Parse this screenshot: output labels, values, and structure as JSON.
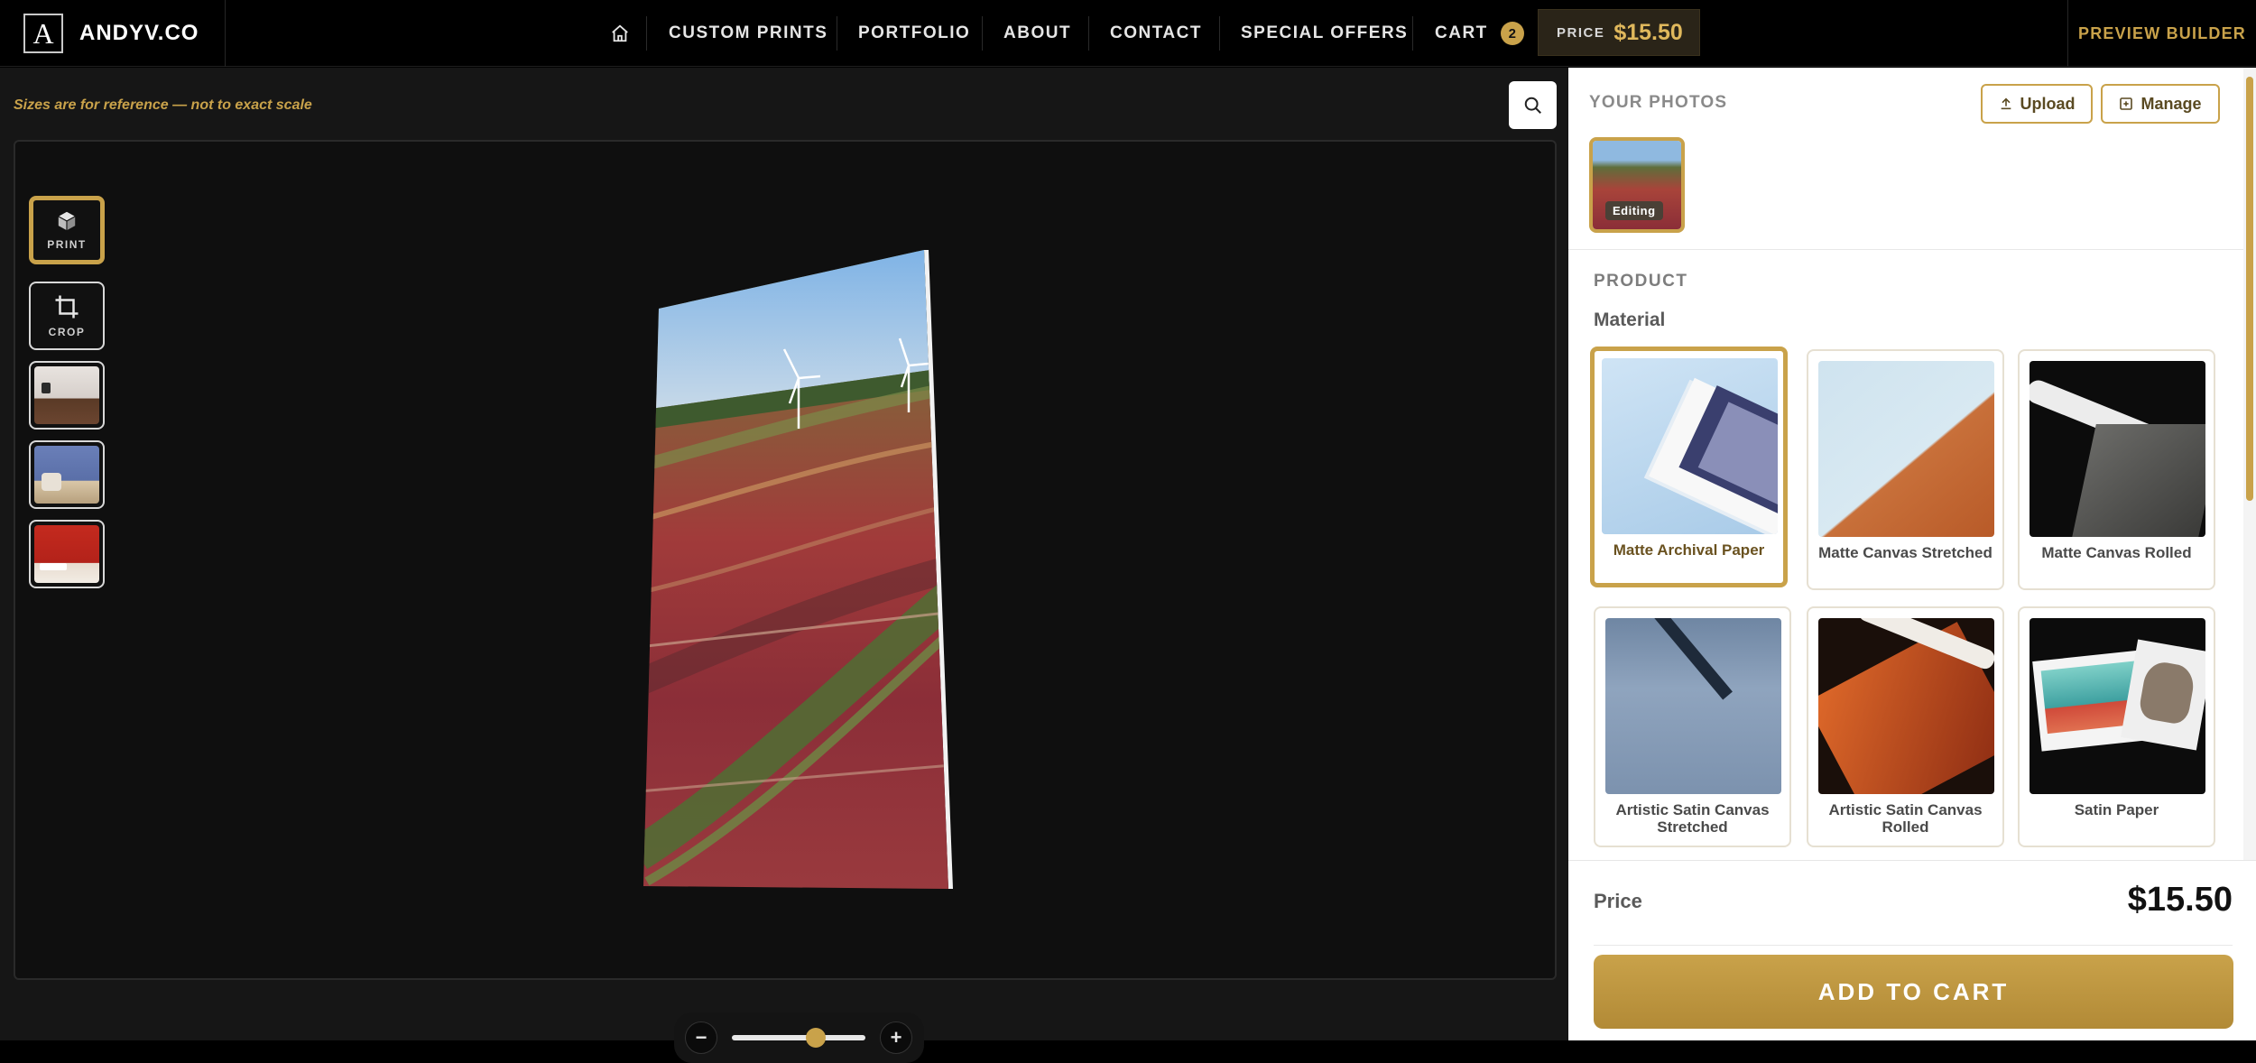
{
  "brand": {
    "logo_letter": "A",
    "name": "ANDYV.CO"
  },
  "nav": {
    "home_icon": "home-icon",
    "links": [
      "CUSTOM PRINTS",
      "PORTFOLIO",
      "ABOUT",
      "CONTACT",
      "SPECIAL OFFERS"
    ],
    "cart_label": "CART",
    "cart_count": "2",
    "price_label": "PRICE",
    "price_value": "$15.50",
    "preview_builder": "PREVIEW BUILDER"
  },
  "workarea": {
    "note": "Sizes are for reference — not to exact scale",
    "search_icon": "magnifier-icon",
    "tools": [
      {
        "label": "PRINT",
        "icon": "cube-icon",
        "active": true
      },
      {
        "label": "CROP",
        "icon": "crop-icon",
        "active": false
      }
    ],
    "room_previews": [
      "room-preview-white-wall",
      "room-preview-blue-wall",
      "room-preview-red-wall"
    ],
    "zoom": {
      "minus": "−",
      "plus": "+",
      "level": 0.65
    }
  },
  "panel": {
    "photos_title": "YOUR PHOTOS",
    "upload_label": "Upload",
    "manage_label": "Manage",
    "editing_tag": "Editing",
    "product_title": "PRODUCT",
    "material_title": "Material",
    "materials": [
      {
        "name": "Matte Archival Paper",
        "selected": true
      },
      {
        "name": "Matte Canvas Stretched",
        "selected": false
      },
      {
        "name": "Matte Canvas Rolled",
        "selected": false
      },
      {
        "name": "Artistic Satin Canvas Stretched",
        "selected": false
      },
      {
        "name": "Artistic Satin Canvas Rolled",
        "selected": false
      },
      {
        "name": "Satin Paper",
        "selected": false
      }
    ],
    "price_label": "Price",
    "price_value": "$15.50",
    "add_to_cart": "ADD TO CART"
  },
  "colors": {
    "accent": "#c9a24a",
    "dark": "#000000",
    "panel": "#ffffff"
  }
}
